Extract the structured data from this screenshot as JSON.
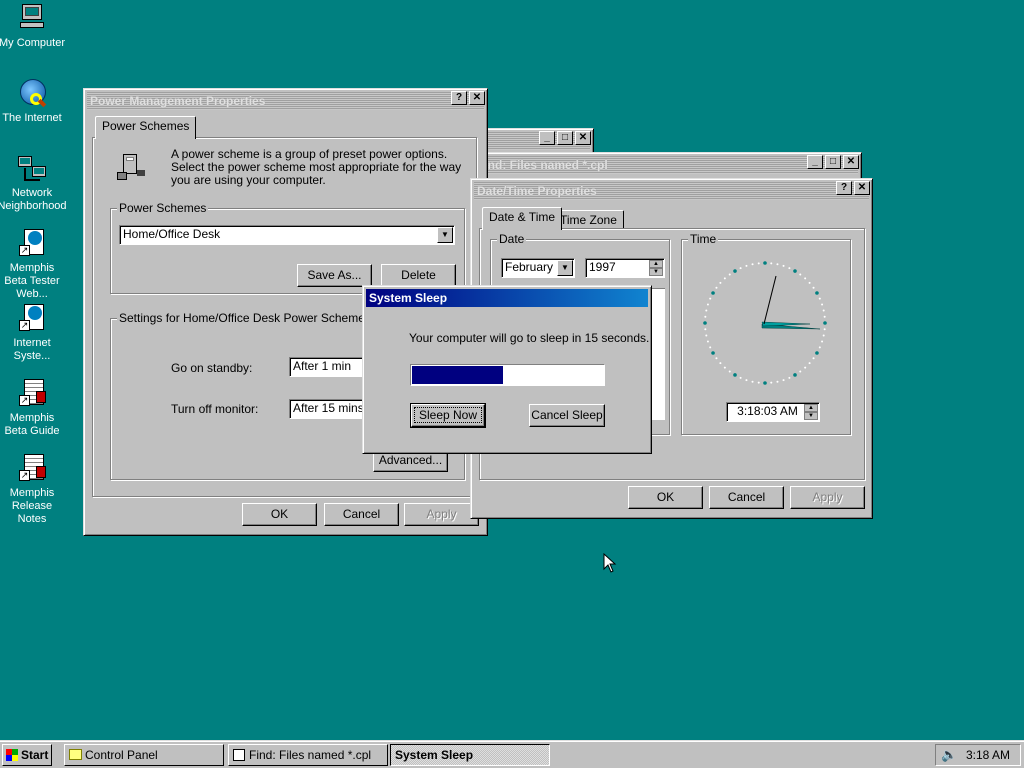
{
  "desktop": {
    "icons": [
      {
        "label": "My Computer"
      },
      {
        "label": "The Internet"
      },
      {
        "label": "Network Neighborhood"
      },
      {
        "label": "Memphis Beta Tester Web..."
      },
      {
        "label": "Internet Syste..."
      },
      {
        "label": "Memphis Beta Guide"
      },
      {
        "label": "Memphis Release Notes"
      }
    ]
  },
  "power_window": {
    "title": "Power Management Properties",
    "tab": "Power Schemes",
    "description": "A power scheme is a group of preset power options. Select the power scheme most appropriate for the way you are using your computer.",
    "schemes_group": "Power Schemes",
    "scheme_selected": "Home/Office Desk",
    "save_as": "Save As...",
    "delete": "Delete",
    "settings_group": "Settings for Home/Office Desk Power Scheme",
    "standby_label": "Go on standby:",
    "standby_value": "After 1 min",
    "monitor_label": "Turn off monitor:",
    "monitor_value": "After 15 mins",
    "advanced": "Advanced...",
    "ok": "OK",
    "cancel": "Cancel",
    "apply": "Apply"
  },
  "find_window": {
    "title": "Find: Files named *.cpl"
  },
  "datetime_window": {
    "title": "Date/Time Properties",
    "tab_date_time": "Date & Time",
    "tab_time_zone": "Time Zone",
    "date_group": "Date",
    "month": "February",
    "year": "1997",
    "time_group": "Time",
    "time_value": "3:18:03 AM",
    "ok": "OK",
    "cancel": "Cancel",
    "apply": "Apply"
  },
  "sleep_dialog": {
    "title": "System Sleep",
    "message": "Your computer will go to sleep in 15 seconds.",
    "progress": 0.47,
    "sleep_now": "Sleep Now",
    "cancel_sleep": "Cancel Sleep"
  },
  "taskbar": {
    "start": "Start",
    "items": [
      {
        "label": "Control Panel"
      },
      {
        "label": "Find: Files named *.cpl"
      },
      {
        "label": "System Sleep"
      }
    ],
    "clock": "3:18 AM"
  },
  "colors": {
    "desktop": "#008080",
    "active_title": "#000080",
    "progress": "#000080"
  }
}
